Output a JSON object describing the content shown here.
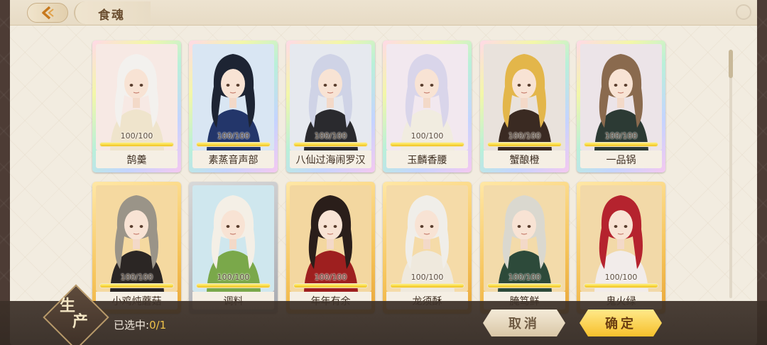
{
  "header": {
    "title": "食魂",
    "back_icon": "chevron-left-icon"
  },
  "cards": [
    {
      "name": "鹄羹",
      "hp": "100/100",
      "hp_fraction": 1.0,
      "frame": "rainbow",
      "hair": "#f3f1ee",
      "outfit": "#efe4cc",
      "bg": "#f7e9e4"
    },
    {
      "name": "素蒸音声部",
      "hp": "100/100",
      "hp_fraction": 1.0,
      "frame": "rainbow",
      "hair": "#1d2433",
      "outfit": "#23366a",
      "bg": "#d9e6f3"
    },
    {
      "name": "八仙过海闹罗汉",
      "hp": "100/100",
      "hp_fraction": 1.0,
      "frame": "rainbow",
      "hair": "#cfd3e6",
      "outfit": "#2a2a2e",
      "bg": "#e6e9ef"
    },
    {
      "name": "玉麟香腰",
      "hp": "100/100",
      "hp_fraction": 1.0,
      "frame": "rainbow",
      "hair": "#d9d5ea",
      "outfit": "#f1ece0",
      "bg": "#f2e8ef"
    },
    {
      "name": "蟹酿橙",
      "hp": "100/100",
      "hp_fraction": 1.0,
      "frame": "rainbow",
      "hair": "#e3b64a",
      "outfit": "#3a2a22",
      "bg": "#e9e2dc"
    },
    {
      "name": "一品锅",
      "hp": "100/100",
      "hp_fraction": 1.0,
      "frame": "rainbow",
      "hair": "#8a6a4e",
      "outfit": "#2c3a34",
      "bg": "#ece4e8"
    },
    {
      "name": "小鸡炖蘑菇",
      "hp": "100/100",
      "hp_fraction": 1.0,
      "frame": "gold",
      "hair": "#9a9488",
      "outfit": "#2b2624",
      "bg": "#f5d9a0"
    },
    {
      "name": "调料",
      "hp": "100/100",
      "hp_fraction": 1.0,
      "frame": "gray",
      "hair": "#f4efe6",
      "outfit": "#7aa84a",
      "bg": "#cfe7ee"
    },
    {
      "name": "年年有余",
      "hp": "100/100",
      "hp_fraction": 1.0,
      "frame": "gold",
      "hair": "#2a1e1a",
      "outfit": "#9e1f1f",
      "bg": "#f3d7a0"
    },
    {
      "name": "龙须酥",
      "hp": "100/100",
      "hp_fraction": 1.0,
      "frame": "gold",
      "hair": "#f0eee9",
      "outfit": "#efe9dd",
      "bg": "#f5dba8"
    },
    {
      "name": "腌笃鲜",
      "hp": "100/100",
      "hp_fraction": 1.0,
      "frame": "gold",
      "hair": "#dad8cf",
      "outfit": "#2d4a3a",
      "bg": "#f3dbaa"
    },
    {
      "name": "鬼火绿",
      "hp": "100/100",
      "hp_fraction": 1.0,
      "frame": "gold",
      "hair": "#b5232e",
      "outfit": "#f2ecea",
      "bg": "#f2d9a8"
    }
  ],
  "footer": {
    "produce_label_1": "生",
    "produce_label_2": "产",
    "selected_label": "已选中:",
    "selected_count": "0/1",
    "cancel_label": "取消",
    "confirm_label": "确定"
  },
  "colors": {
    "accent_gold": "#f6c02b",
    "hp_fill": "#f0c21e",
    "panel": "#f2ece0",
    "frame_dark": "#4d3c35"
  }
}
